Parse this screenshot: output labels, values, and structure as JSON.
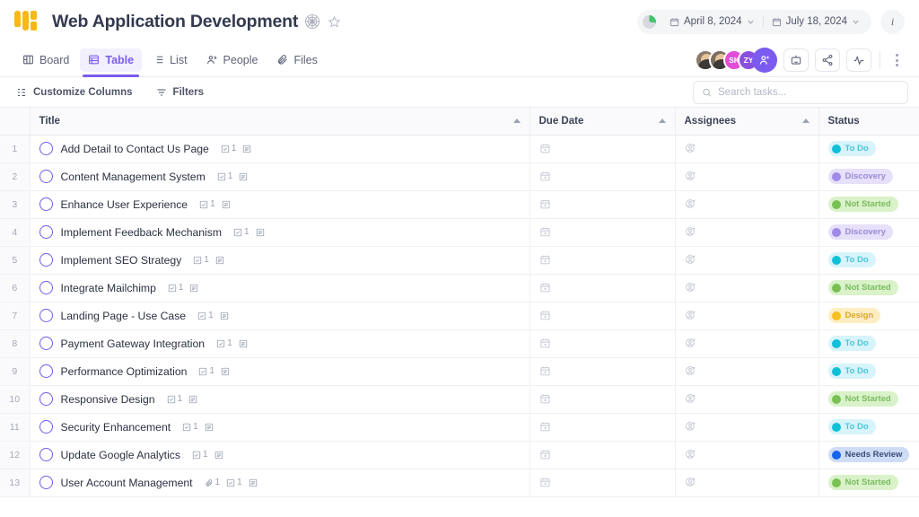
{
  "header": {
    "logo_icon": "grid-logo-icon",
    "project_title": "Web Application Development",
    "title_emoji_icon": "spiderweb-icon",
    "favorite_icon": "star-outline-icon",
    "progress_icon": "pie-progress-icon",
    "start_date": "April 8, 2024",
    "end_date": "July 18, 2024",
    "calendar_icon": "calendar-icon",
    "chevron_icon": "chevron-down-icon",
    "info_label": "i"
  },
  "tabs": [
    {
      "label": "Board",
      "icon": "board-icon",
      "active": false
    },
    {
      "label": "Table",
      "icon": "table-icon",
      "active": true
    },
    {
      "label": "List",
      "icon": "list-icon",
      "active": false
    },
    {
      "label": "People",
      "icon": "people-icon",
      "active": false
    },
    {
      "label": "Files",
      "icon": "paperclip-icon",
      "active": false
    }
  ],
  "members": [
    {
      "type": "photo",
      "initials": "",
      "color": "#8c7b6b"
    },
    {
      "type": "photo",
      "initials": "",
      "color": "#7d6e60"
    },
    {
      "type": "initials",
      "initials": "SK",
      "color": "#e24dd6"
    },
    {
      "type": "initials",
      "initials": "ZY",
      "color": "#8b4fe0"
    }
  ],
  "add_member_icon": "add-person-icon",
  "actions": [
    {
      "icon": "robot-icon"
    },
    {
      "icon": "share-icon"
    },
    {
      "icon": "activity-icon"
    }
  ],
  "more_icon": "more-vertical-icon",
  "toolbar": {
    "customize_columns": "Customize Columns",
    "customize_icon": "columns-icon",
    "filters": "Filters",
    "filters_icon": "filter-icon"
  },
  "search": {
    "placeholder": "Search tasks...",
    "value": "",
    "icon": "search-icon"
  },
  "table": {
    "columns": [
      {
        "label": "Title",
        "sortable": true
      },
      {
        "label": "Due Date",
        "sortable": true
      },
      {
        "label": "Assignees",
        "sortable": true
      },
      {
        "label": "Status",
        "sortable": false
      }
    ],
    "due_date_icon": "calendar-plus-icon",
    "assignee_icon": "person-plus-icon",
    "rows": [
      {
        "num": "1",
        "title": "Add Detail to Contact Us Page",
        "attachments": "",
        "subtasks": "1",
        "status": "To Do",
        "status_dot": "#0fbfd8",
        "status_bg": "#d6f4fa",
        "status_fg": "#49c6db"
      },
      {
        "num": "2",
        "title": "Content Management System",
        "attachments": "",
        "subtasks": "1",
        "status": "Discovery",
        "status_dot": "#a08ae8",
        "status_bg": "#e6e0fa",
        "status_fg": "#9b8ad6"
      },
      {
        "num": "3",
        "title": "Enhance User Experience",
        "attachments": "",
        "subtasks": "1",
        "status": "Not Started",
        "status_dot": "#79c154",
        "status_bg": "#d9f2c9",
        "status_fg": "#7bbb60"
      },
      {
        "num": "4",
        "title": "Implement Feedback Mechanism",
        "attachments": "",
        "subtasks": "1",
        "status": "Discovery",
        "status_dot": "#a08ae8",
        "status_bg": "#e6e0fa",
        "status_fg": "#9b8ad6"
      },
      {
        "num": "5",
        "title": "Implement SEO Strategy",
        "attachments": "",
        "subtasks": "1",
        "status": "To Do",
        "status_dot": "#0fbfd8",
        "status_bg": "#d6f4fa",
        "status_fg": "#49c6db"
      },
      {
        "num": "6",
        "title": "Integrate Mailchimp",
        "attachments": "",
        "subtasks": "1",
        "status": "Not Started",
        "status_dot": "#79c154",
        "status_bg": "#d9f2c9",
        "status_fg": "#7bbb60"
      },
      {
        "num": "7",
        "title": "Landing Page - Use Case",
        "attachments": "",
        "subtasks": "1",
        "status": "Design",
        "status_dot": "#f5c022",
        "status_bg": "#fdeec2",
        "status_fg": "#d9a820"
      },
      {
        "num": "8",
        "title": "Payment Gateway Integration",
        "attachments": "",
        "subtasks": "1",
        "status": "To Do",
        "status_dot": "#0fbfd8",
        "status_bg": "#d6f4fa",
        "status_fg": "#49c6db"
      },
      {
        "num": "9",
        "title": "Performance Optimization",
        "attachments": "",
        "subtasks": "1",
        "status": "To Do",
        "status_dot": "#0fbfd8",
        "status_bg": "#d6f4fa",
        "status_fg": "#49c6db"
      },
      {
        "num": "10",
        "title": "Responsive Design",
        "attachments": "",
        "subtasks": "1",
        "status": "Not Started",
        "status_dot": "#79c154",
        "status_bg": "#d9f2c9",
        "status_fg": "#7bbb60"
      },
      {
        "num": "11",
        "title": "Security Enhancement",
        "attachments": "",
        "subtasks": "1",
        "status": "To Do",
        "status_dot": "#0fbfd8",
        "status_bg": "#d6f4fa",
        "status_fg": "#49c6db"
      },
      {
        "num": "12",
        "title": "Update Google Analytics",
        "attachments": "",
        "subtasks": "1",
        "status": "Needs Review",
        "status_dot": "#1565f0",
        "status_bg": "#cfdcf5",
        "status_fg": "#3a4f7a"
      },
      {
        "num": "13",
        "title": "User Account Management",
        "attachments": "1",
        "subtasks": "1",
        "status": "Not Started",
        "status_dot": "#79c154",
        "status_bg": "#d9f2c9",
        "status_fg": "#7bbb60"
      }
    ]
  },
  "colors": {
    "accent": "#7b5cf0",
    "logo": "#f9b818",
    "text": "#2f3445"
  }
}
